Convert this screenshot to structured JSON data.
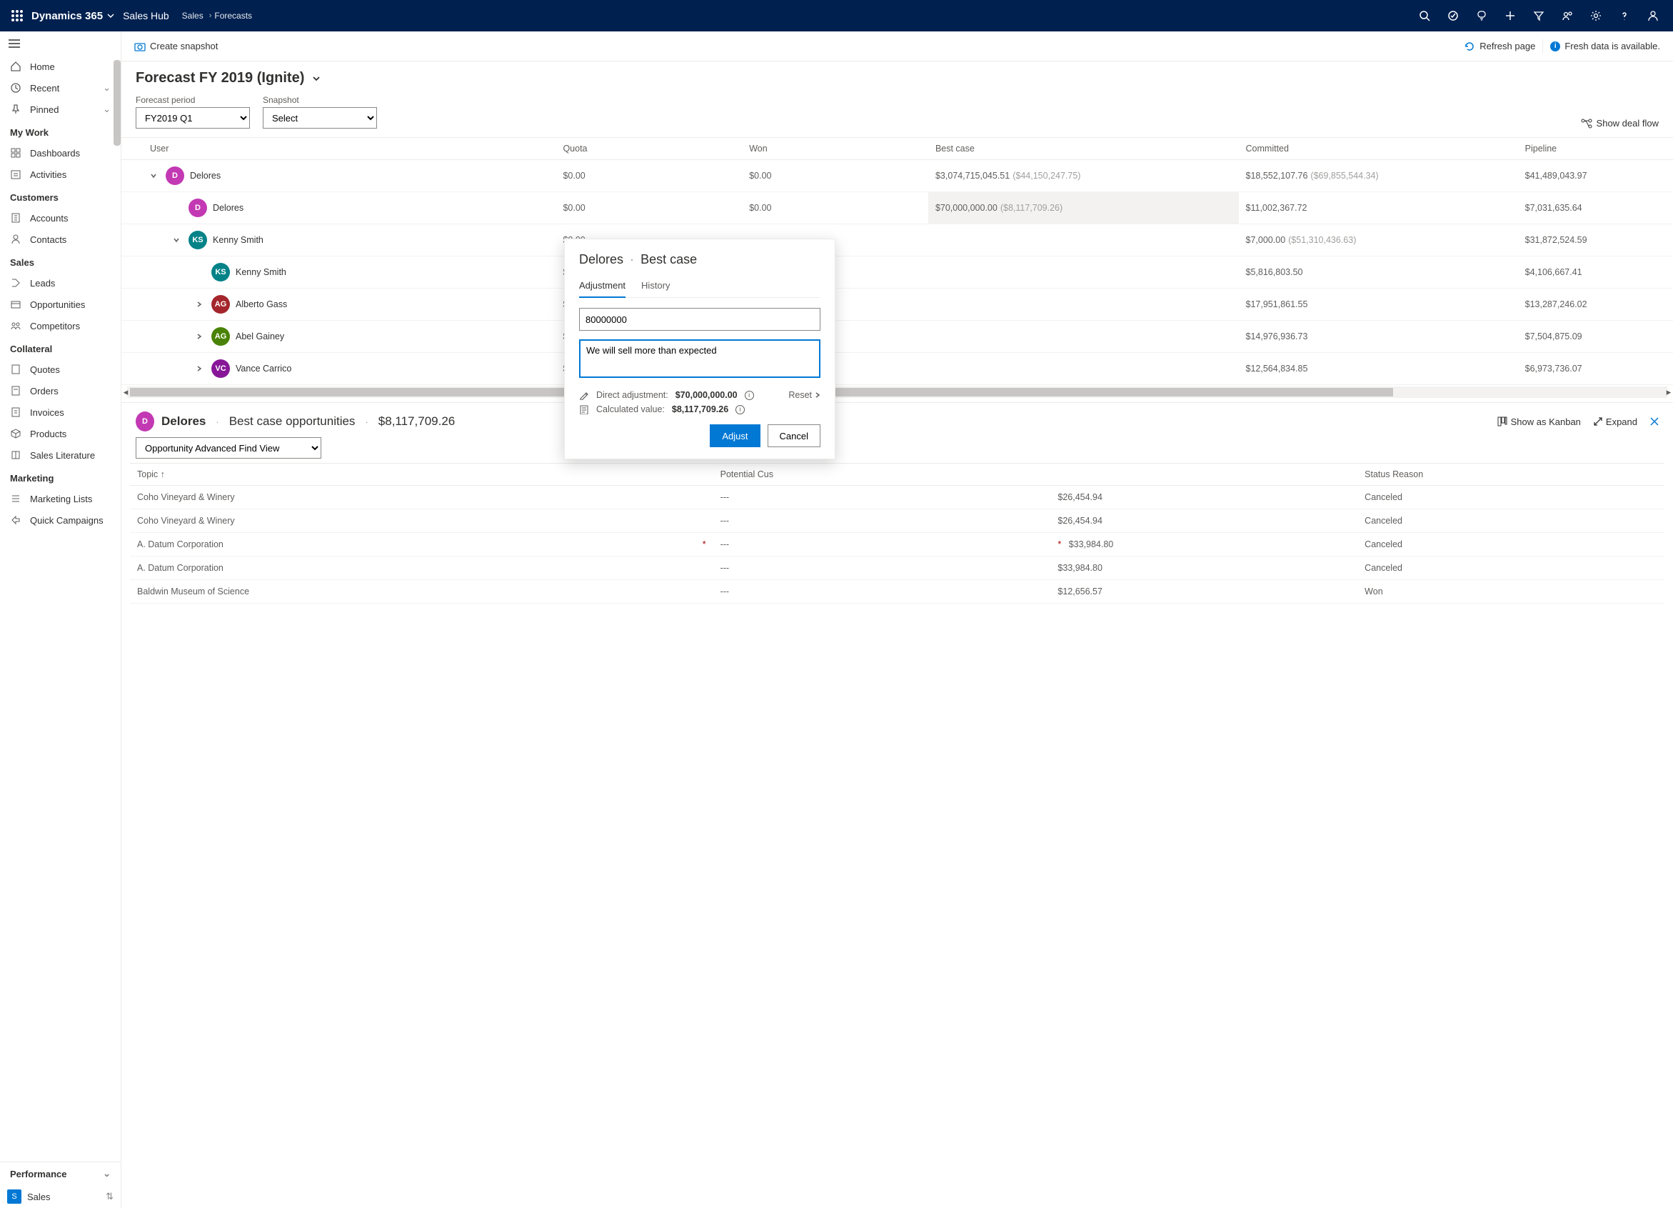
{
  "topbar": {
    "brand": "Dynamics 365",
    "app": "Sales Hub",
    "crumb1": "Sales",
    "crumb2": "Forecasts"
  },
  "sidebar": {
    "home": "Home",
    "recent": "Recent",
    "pinned": "Pinned",
    "groups": {
      "mywork": "My Work",
      "customers": "Customers",
      "sales": "Sales",
      "collateral": "Collateral",
      "marketing": "Marketing",
      "performance": "Performance"
    },
    "items": {
      "dashboards": "Dashboards",
      "activities": "Activities",
      "accounts": "Accounts",
      "contacts": "Contacts",
      "leads": "Leads",
      "opportunities": "Opportunities",
      "competitors": "Competitors",
      "quotes": "Quotes",
      "orders": "Orders",
      "invoices": "Invoices",
      "products": "Products",
      "saleslit": "Sales Literature",
      "mktlists": "Marketing Lists",
      "quickcamp": "Quick Campaigns"
    },
    "saleslink": "Sales",
    "salesbadge": "S"
  },
  "cmdbar": {
    "snapshot": "Create snapshot",
    "refresh": "Refresh page",
    "fresh": "Fresh data is available."
  },
  "page": {
    "title": "Forecast FY 2019 (Ignite)",
    "period_label": "Forecast period",
    "period_value": "FY2019 Q1",
    "snapshot_label": "Snapshot",
    "snapshot_value": "Select",
    "dealflow": "Show deal flow"
  },
  "grid": {
    "cols": {
      "user": "User",
      "quota": "Quota",
      "won": "Won",
      "best": "Best case",
      "committed": "Committed",
      "pipeline": "Pipeline"
    },
    "rows": [
      {
        "name": "Delores",
        "initials": "D",
        "color": "#c239b3",
        "indent": 1,
        "exp": "open",
        "quota": "$0.00",
        "won": "$0.00",
        "best": "$3,074,715,045.51",
        "bestsub": "($44,150,247.75)",
        "committed": "$18,552,107.76",
        "committedsub": "($69,855,544.34)",
        "pipeline": "$41,489,043.97"
      },
      {
        "name": "Delores",
        "initials": "D",
        "color": "#c239b3",
        "indent": 2,
        "exp": "",
        "quota": "$0.00",
        "won": "$0.00",
        "best": "$70,000,000.00",
        "bestsub": "($8,117,709.26)",
        "hl": true,
        "committed": "$11,002,367.72",
        "pipeline": "$7,031,635.64"
      },
      {
        "name": "Kenny Smith",
        "initials": "KS",
        "color": "#038387",
        "indent": 2,
        "exp": "open",
        "quota": "$0.00",
        "won": "",
        "best": "",
        "committed": "$7,000.00",
        "committedsub": "($51,310,436.63)",
        "pipeline": "$31,872,524.59"
      },
      {
        "name": "Kenny Smith",
        "initials": "KS",
        "color": "#038387",
        "indent": 3,
        "exp": "",
        "quota": "$0.00",
        "won": "",
        "best": "",
        "committed": "$5,816,803.50",
        "pipeline": "$4,106,667.41"
      },
      {
        "name": "Alberto Gass",
        "initials": "AG",
        "color": "#a4262c",
        "indent": 3,
        "exp": "right",
        "quota": "$0.00",
        "won": "",
        "best": "",
        "committed": "$17,951,861.55",
        "pipeline": "$13,287,246.02"
      },
      {
        "name": "Abel Gainey",
        "initials": "AG",
        "color": "#498205",
        "indent": 3,
        "exp": "right",
        "quota": "$0.00",
        "won": "",
        "best": "",
        "committed": "$14,976,936.73",
        "pipeline": "$7,504,875.09"
      },
      {
        "name": "Vance Carrico",
        "initials": "VC",
        "color": "#881798",
        "indent": 3,
        "exp": "right",
        "quota": "$0.00",
        "won": "",
        "best": "",
        "committed": "$12,564,834.85",
        "pipeline": "$6,973,736.07"
      }
    ]
  },
  "detail": {
    "user": "Delores",
    "initials": "D",
    "color": "#c239b3",
    "section": "Best case opportunities",
    "amount": "$8,117,709.26",
    "kanban": "Show as Kanban",
    "expand": "Expand",
    "view": "Opportunity Advanced Find View"
  },
  "opps": {
    "cols": {
      "topic": "Topic",
      "cust": "Potential Cus",
      "rev": "",
      "status": "Status Reason"
    },
    "rows": [
      {
        "topic": "Coho Vineyard & Winery",
        "cust": "---",
        "rev": "$26,454.94",
        "status": "Canceled"
      },
      {
        "topic": "Coho Vineyard & Winery",
        "cust": "---",
        "rev": "$26,454.94",
        "status": "Canceled"
      },
      {
        "topic": "A. Datum Corporation",
        "cust": "---",
        "rev": "$33,984.80",
        "status": "Canceled",
        "star": true
      },
      {
        "topic": "A. Datum Corporation",
        "cust": "---",
        "rev": "$33,984.80",
        "status": "Canceled"
      },
      {
        "topic": "Baldwin Museum of Science",
        "cust": "---",
        "rev": "$12,656.57",
        "status": "Won"
      }
    ]
  },
  "popover": {
    "user": "Delores",
    "field": "Best case",
    "tab_adj": "Adjustment",
    "tab_hist": "History",
    "value": "80000000",
    "note": "We will sell more than expected",
    "direct_label": "Direct adjustment:",
    "direct_value": "$70,000,000.00",
    "calc_label": "Calculated value:",
    "calc_value": "$8,117,709.26",
    "reset": "Reset",
    "adjust": "Adjust",
    "cancel": "Cancel"
  }
}
